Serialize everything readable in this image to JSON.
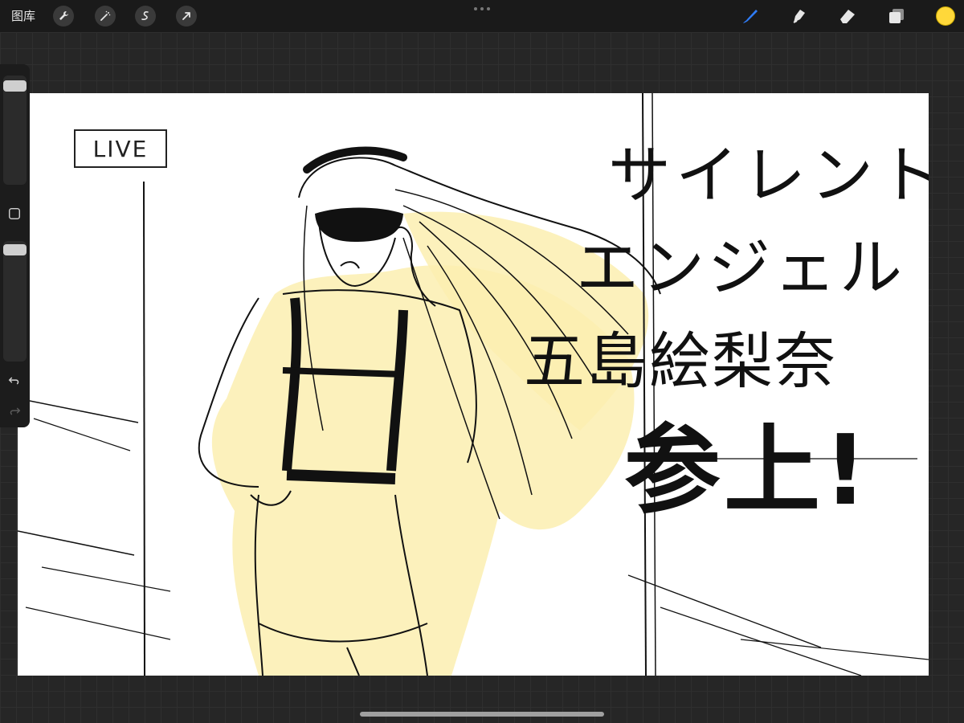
{
  "toolbar": {
    "gallery_label": "图库",
    "left_tools": [
      {
        "name": "wrench-icon"
      },
      {
        "name": "magic-wand-icon"
      },
      {
        "name": "selection-icon"
      },
      {
        "name": "transform-arrow-icon"
      }
    ],
    "right_tools": [
      {
        "name": "brush-icon",
        "active": true
      },
      {
        "name": "smudge-icon",
        "active": false
      },
      {
        "name": "eraser-icon",
        "active": false
      },
      {
        "name": "layers-icon",
        "active": false
      }
    ],
    "active_color": "#ffd83a",
    "accent_color": "#2f7cf6"
  },
  "sidebar": {
    "brush_size_label": "",
    "opacity_label": "",
    "buttons": [
      "square-modify-icon",
      "undo-icon",
      "redo-icon"
    ]
  },
  "canvas": {
    "sign_text": "LIVE",
    "title_lines": [
      "サイレント",
      "エンジェル",
      "五島絵梨奈",
      "参上!"
    ]
  }
}
